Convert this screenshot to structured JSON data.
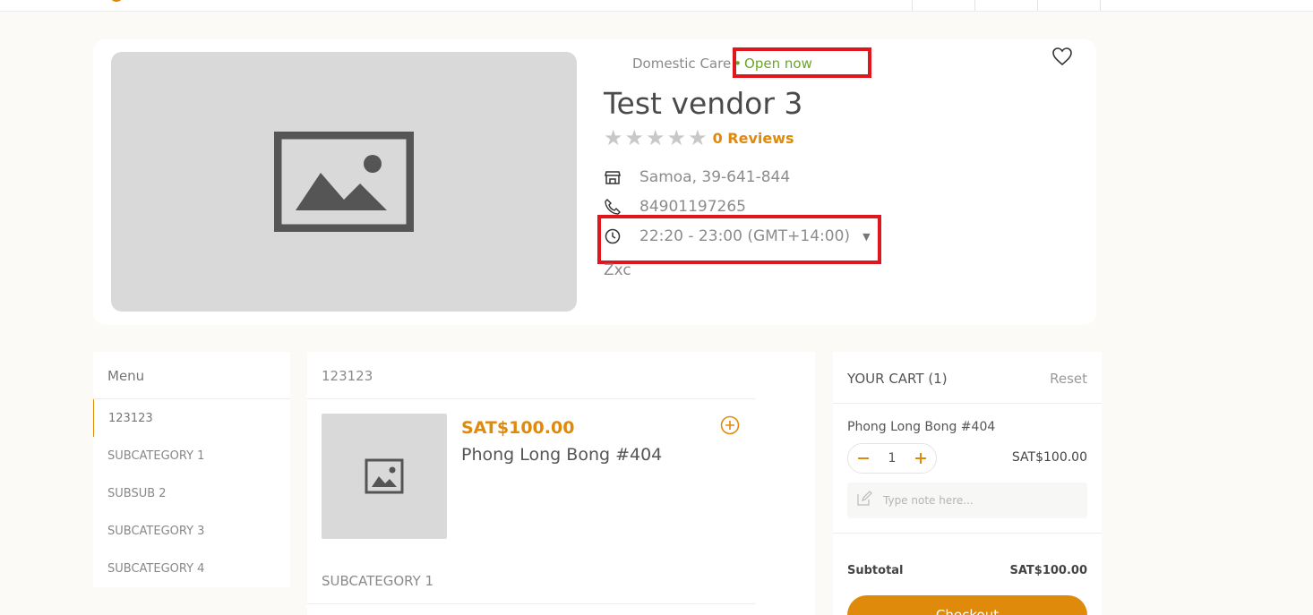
{
  "vendor": {
    "category": "Domestic Care",
    "open_status": "Open now",
    "name": "Test vendor 3",
    "reviews_label": "0 Reviews",
    "address": "Samoa, 39-641-844",
    "phone": "84901197265",
    "hours": "22:20 - 23:00  (GMT+14:00)",
    "description": "Zxc",
    "rating": 0
  },
  "menu": {
    "title": "Menu",
    "items": [
      {
        "label": "123123"
      },
      {
        "label": "SUBCATEGORY 1"
      },
      {
        "label": "SUBSUB 2"
      },
      {
        "label": "SUBCATEGORY 3"
      },
      {
        "label": "SUBCATEGORY 4"
      }
    ]
  },
  "products": {
    "sections": [
      {
        "title": "123123"
      },
      {
        "title": "SUBCATEGORY 1"
      }
    ],
    "items": [
      {
        "price": "SAT$100.00",
        "name": "Phong Long Bong #404"
      }
    ]
  },
  "cart": {
    "title": "YOUR CART (1)",
    "reset_label": "Reset",
    "item_name": "Phong Long Bong #404",
    "quantity": "1",
    "item_price": "SAT$100.00",
    "note_placeholder": "Type note here...",
    "subtotal_label": "Subtotal",
    "subtotal_value": "SAT$100.00",
    "checkout_label": "Checkout"
  },
  "colors": {
    "accent": "#e08a0c",
    "open": "#6aa52b",
    "highlight": "#e0161e",
    "placeholder_bg": "#d9d9d9"
  }
}
